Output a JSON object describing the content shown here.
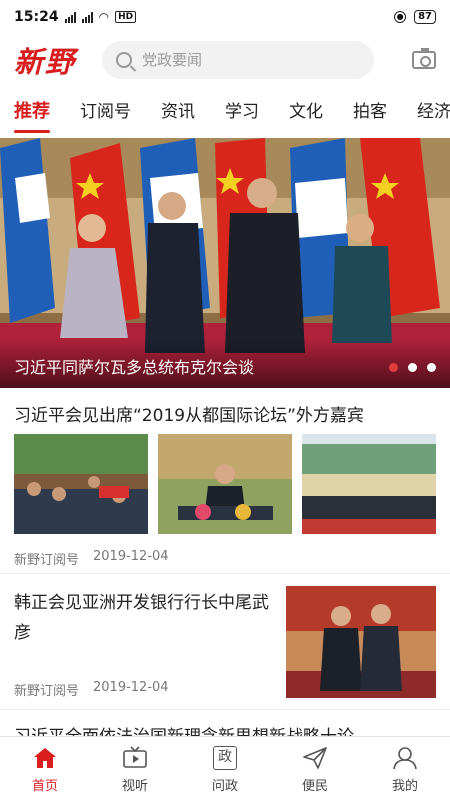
{
  "status_bar": {
    "time": "15:24",
    "network_label": "HD",
    "battery": "87"
  },
  "header": {
    "logo": "新野",
    "search_placeholder": "党政要闻",
    "camera_icon": "camera-icon"
  },
  "tabs": [
    {
      "label": "推荐",
      "active": true
    },
    {
      "label": "订阅号",
      "active": false
    },
    {
      "label": "资讯",
      "active": false
    },
    {
      "label": "学习",
      "active": false
    },
    {
      "label": "文化",
      "active": false
    },
    {
      "label": "拍客",
      "active": false
    },
    {
      "label": "经济",
      "active": false
    }
  ],
  "banner": {
    "caption": "习近平同萨尔瓦多总统布克尔会谈",
    "slide_count": 3,
    "active_slide": 1
  },
  "articles": [
    {
      "title": "习近平会见出席“2019从都国际论坛”外方嘉宾",
      "source": "新野订阅号",
      "date": "2019-12-04"
    },
    {
      "title": "韩正会见亚洲开发银行行长中尾武彦",
      "source": "新野订阅号",
      "date": "2019-12-04"
    },
    {
      "title": "习近平全面依法治国新理念新思想新战略十论"
    }
  ],
  "bottom_nav": [
    {
      "label": "首页",
      "icon": "home-icon",
      "active": true
    },
    {
      "label": "视听",
      "icon": "tv-icon",
      "active": false
    },
    {
      "label": "问政",
      "icon": "zheng-icon",
      "glyph": "政",
      "active": false
    },
    {
      "label": "便民",
      "icon": "send-icon",
      "active": false
    },
    {
      "label": "我的",
      "icon": "user-icon",
      "active": false
    }
  ],
  "colors": {
    "accent": "#d81e1e",
    "text": "#222222",
    "meta": "#777777"
  }
}
